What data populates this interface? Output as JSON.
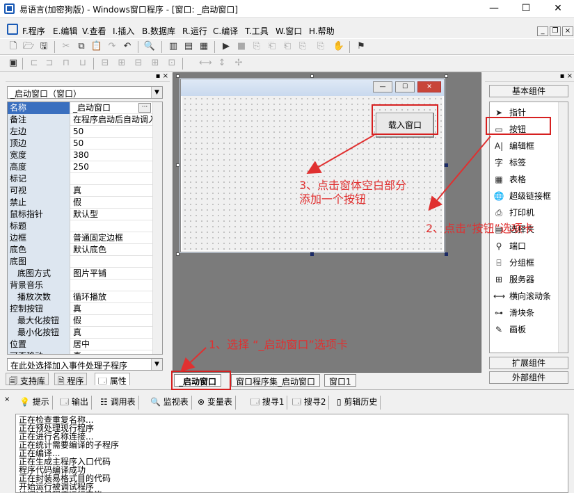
{
  "window": {
    "title": "易语言(加密狗版) - Windows窗口程序 - [窗口: _启动窗口]",
    "min": "—",
    "max": "☐",
    "close": "✕"
  },
  "menu": {
    "items": [
      "F.程序",
      "E.编辑",
      "V.查看",
      "I.插入",
      "B.数据库",
      "R.运行",
      "C.编译",
      "T.工具",
      "W.窗口",
      "H.帮助"
    ],
    "mdi_min": "_",
    "mdi_restore": "❐",
    "mdi_close": "×"
  },
  "leftpanel": {
    "header_btns": "▪ ×",
    "object_select": "_启动窗口（窗口）",
    "properties": [
      {
        "name": "名称",
        "value": "_启动窗口",
        "sel": true
      },
      {
        "name": "备注",
        "value": "在程序启动后自动调入"
      },
      {
        "name": "左边",
        "value": "50"
      },
      {
        "name": "顶边",
        "value": "50"
      },
      {
        "name": "宽度",
        "value": "380"
      },
      {
        "name": "高度",
        "value": "250"
      },
      {
        "name": "标记",
        "value": ""
      },
      {
        "name": "可视",
        "value": "真"
      },
      {
        "name": "禁止",
        "value": "假"
      },
      {
        "name": "鼠标指针",
        "value": "默认型"
      },
      {
        "name": "标题",
        "value": ""
      },
      {
        "name": "边框",
        "value": "普通固定边框"
      },
      {
        "name": "底色",
        "value": "默认底色"
      },
      {
        "name": "底图",
        "value": ""
      },
      {
        "name": "底图方式",
        "value": "图片平铺",
        "sub": true
      },
      {
        "name": "背景音乐",
        "value": ""
      },
      {
        "name": "播放次数",
        "value": "循环播放",
        "sub": true
      },
      {
        "name": "控制按钮",
        "value": "真"
      },
      {
        "name": "最大化按钮",
        "value": "假",
        "sub": true
      },
      {
        "name": "最小化按钮",
        "value": "真",
        "sub": true
      },
      {
        "name": "位置",
        "value": "居中"
      },
      {
        "name": "可否移动",
        "value": "真"
      }
    ],
    "event_select": "在此处选择加入事件处理子程序",
    "tabs": [
      "支持库",
      "程序",
      "属性"
    ]
  },
  "form": {
    "button_label": "载入窗口",
    "min": "—",
    "max": "☐",
    "close": "✕"
  },
  "doc_tabs": [
    "_启动窗口",
    "窗口程序集_启动窗口",
    "窗口1"
  ],
  "rightpanel": {
    "basic_label": "基本组件",
    "components": [
      {
        "label": "指针",
        "icon": "pointer-icon",
        "glyph": "➤"
      },
      {
        "label": "按钮",
        "icon": "button-icon",
        "glyph": "▭"
      },
      {
        "label": "编辑框",
        "icon": "editbox-icon",
        "glyph": "A|"
      },
      {
        "label": "标签",
        "icon": "label-icon",
        "glyph": "字"
      },
      {
        "label": "表格",
        "icon": "table-icon",
        "glyph": "▦"
      },
      {
        "label": "超级链接框",
        "icon": "hyperlink-icon",
        "glyph": "🌐"
      },
      {
        "label": "打印机",
        "icon": "printer-icon",
        "glyph": "⎙"
      },
      {
        "label": "选择夹",
        "icon": "tab-icon",
        "glyph": "▤"
      },
      {
        "label": "端口",
        "icon": "port-icon",
        "glyph": "⚲"
      },
      {
        "label": "分组框",
        "icon": "groupbox-icon",
        "glyph": "⌸"
      },
      {
        "label": "服务器",
        "icon": "server-icon",
        "glyph": "⊞"
      },
      {
        "label": "横向滚动条",
        "icon": "hscroll-icon",
        "glyph": "⟷"
      },
      {
        "label": "滑块条",
        "icon": "slider-icon",
        "glyph": "⊶"
      },
      {
        "label": "画板",
        "icon": "canvas-icon",
        "glyph": "✎"
      }
    ],
    "ext_label": "扩展组件",
    "ext2_label": "外部组件"
  },
  "bottom": {
    "tabs": [
      "提示",
      "输出",
      "调用表",
      "监视表",
      "变量表",
      "搜寻1",
      "搜寻2",
      "剪辑历史"
    ],
    "output_lines": [
      "正在检查重复名称...",
      "正在预处理现行程序",
      "正在进行名称连接...",
      "正在统计需要编译的子程序",
      "正在编译...",
      "正在生成主程序入口代码",
      "程序代码编译成功",
      "正在封装易格式目的代码",
      "开始运行被调试程序",
      "被调试易程序运行完毕"
    ]
  },
  "annotations": {
    "step1": "1、选择 “_启动窗口”选项卡",
    "step2": "2、点击“按钮”选项卡",
    "step3_line1": "3、点击窗体空白部分",
    "step3_line2": "添加一个按钮"
  },
  "colors": {
    "annotation": "#e03030",
    "selected": "#3a6fbf"
  }
}
